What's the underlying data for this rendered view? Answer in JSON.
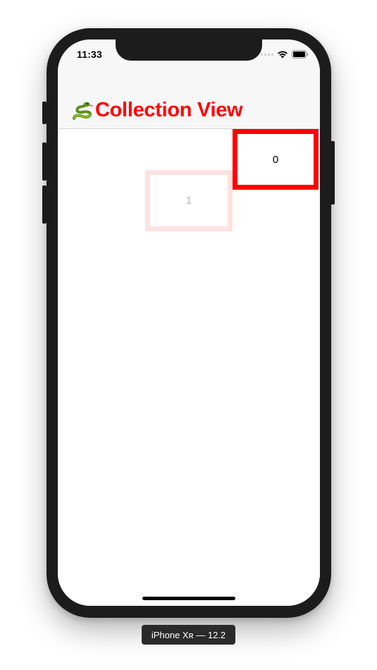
{
  "status_bar": {
    "time": "11:33",
    "icons": [
      "cellular-signal-icon",
      "wifi-icon",
      "battery-icon"
    ]
  },
  "nav": {
    "title_emoji_icon": "snake-icon",
    "title": "Collection View",
    "title_color": "#ff0000"
  },
  "collection": {
    "cells": [
      {
        "label": "0",
        "border_color": "#ff0000"
      },
      {
        "label": "1",
        "border_color": "#ffe1e1"
      }
    ]
  },
  "device": {
    "label": "iPhone Xʀ — 12.2"
  }
}
